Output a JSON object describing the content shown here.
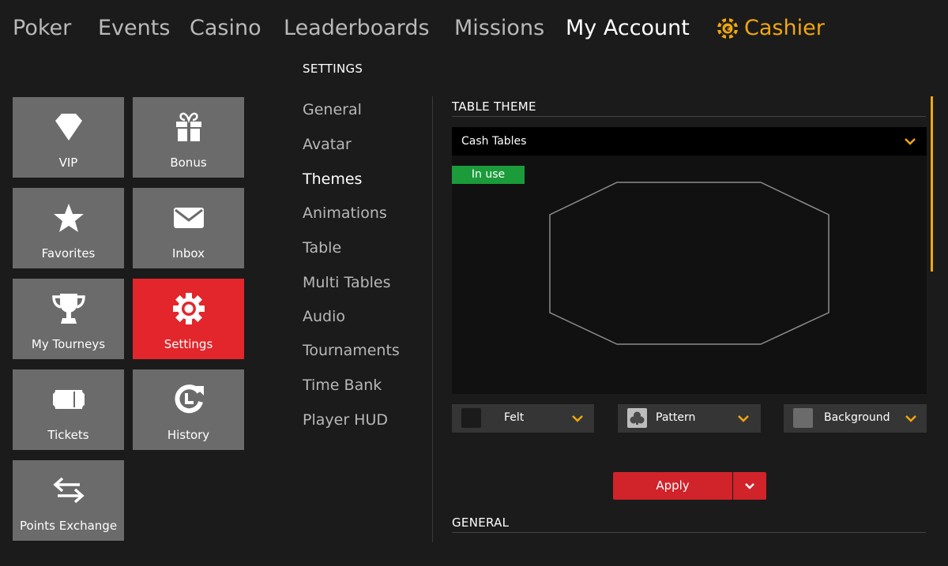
{
  "nav": {
    "items": [
      "Poker",
      "Events",
      "Casino",
      "Leaderboards",
      "Missions",
      "My Account"
    ],
    "cashier": "Cashier",
    "active": "My Account"
  },
  "tiles": [
    {
      "label": "VIP",
      "icon": "diamond-icon"
    },
    {
      "label": "Bonus",
      "icon": "gift-icon"
    },
    {
      "label": "Favorites",
      "icon": "star-icon"
    },
    {
      "label": "Inbox",
      "icon": "envelope-icon"
    },
    {
      "label": "My Tourneys",
      "icon": "trophy-icon"
    },
    {
      "label": "Settings",
      "icon": "gear-icon"
    },
    {
      "label": "Tickets",
      "icon": "ticket-icon"
    },
    {
      "label": "History",
      "icon": "history-icon"
    },
    {
      "label": "Points Exchange",
      "icon": "exchange-arrows-icon"
    }
  ],
  "settings": {
    "heading": "SETTINGS",
    "menu": [
      "General",
      "Avatar",
      "Themes",
      "Animations",
      "Table",
      "Multi Tables",
      "Audio",
      "Tournaments",
      "Time Bank",
      "Player HUD"
    ],
    "active": "Themes"
  },
  "table_theme": {
    "title": "TABLE THEME",
    "selected": "Cash Tables",
    "badge": "In use",
    "options": [
      {
        "label": "Felt"
      },
      {
        "label": "Pattern"
      },
      {
        "label": "Background"
      }
    ]
  },
  "apply": {
    "label": "Apply"
  },
  "general": {
    "title": "GENERAL"
  },
  "colors": {
    "accent": "#f0a70f",
    "active_tile": "#e2262b",
    "apply": "#d0232a",
    "badge": "#1b9b3a",
    "tile": "#6b6b6b"
  }
}
